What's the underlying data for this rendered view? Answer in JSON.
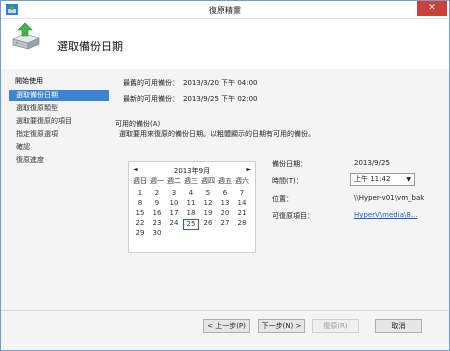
{
  "window": {
    "title": "復原精靈",
    "close_glyph": "✕"
  },
  "header": {
    "page_title": "選取備份日期"
  },
  "sidebar": {
    "heading": "開始使用",
    "items": [
      {
        "label": "選取備份日期",
        "selected": true
      },
      {
        "label": "選取復原類型",
        "selected": false
      },
      {
        "label": "選取要復原的項目",
        "selected": false
      },
      {
        "label": "指定復原選項",
        "selected": false
      },
      {
        "label": "確認",
        "selected": false
      },
      {
        "label": "復原進度",
        "selected": false
      }
    ]
  },
  "info": {
    "oldest_label": "最舊的可用備份：",
    "oldest_value": "2013/3/20 下午 04:00",
    "newest_label": "最新的可用備份：",
    "newest_value": "2013/9/25 下午 02:00"
  },
  "available": {
    "label": "可用的備份(A)",
    "description": "選取要用來復原的備份日期。以粗體顯示的日期有可用的備份。"
  },
  "calendar": {
    "prev": "◄",
    "next": "►",
    "month": "2013年9月",
    "weekdays": [
      "週日",
      "週一",
      "週二",
      "週三",
      "週四",
      "週五",
      "週六"
    ],
    "weeks": [
      [
        "1",
        "2",
        "3",
        "4",
        "5",
        "6",
        "7"
      ],
      [
        "8",
        "9",
        "10",
        "11",
        "12",
        "13",
        "14"
      ],
      [
        "15",
        "16",
        "17",
        "18",
        "19",
        "20",
        "21"
      ],
      [
        "22",
        "23",
        "24",
        "25",
        "26",
        "27",
        "28"
      ],
      [
        "29",
        "30",
        "",
        "",
        "",
        "",
        ""
      ]
    ],
    "selected_day": "25"
  },
  "details": {
    "backup_date_label": "備份日期：",
    "backup_date_value": "2013/9/25",
    "time_label": "時間(T)：",
    "time_value": "上午 11:42",
    "location_label": "位置：",
    "location_value": "\\\\Hyper-v01\\vm_bak",
    "recoverable_label": "可復原項目：",
    "recoverable_value": "HyperV\\media\\8..."
  },
  "buttons": {
    "back": "< 上一步(P)",
    "next": "下一步(N) >",
    "recover": "復原(R)",
    "cancel": "取消"
  },
  "colors": {
    "selected_item": "#3c83d1",
    "link": "#1a5ec7",
    "close": "#c7403a"
  }
}
